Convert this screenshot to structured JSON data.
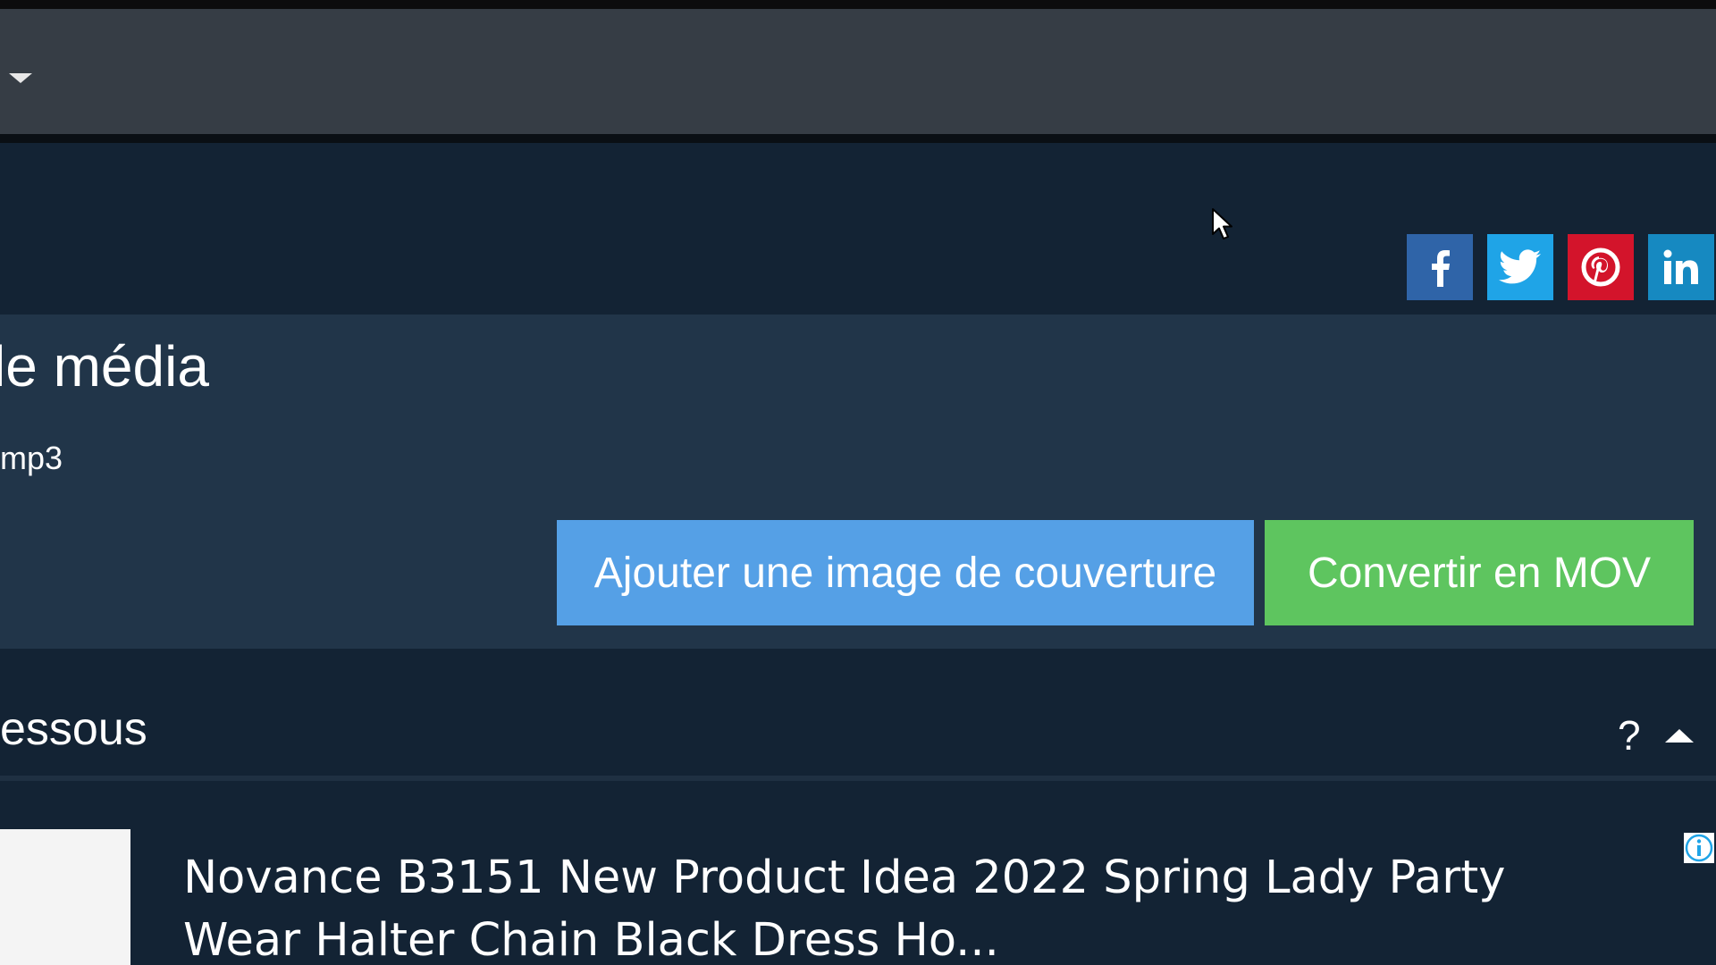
{
  "header": {
    "share_buttons": [
      {
        "name": "Facebook",
        "icon": "facebook-icon",
        "color": "#2f64a8"
      },
      {
        "name": "Twitter",
        "icon": "twitter-icon",
        "color": "#1fa4e7"
      },
      {
        "name": "Pinterest",
        "icon": "pinterest-icon",
        "color": "#d3142b"
      },
      {
        "name": "LinkedIn",
        "icon": "linkedin-icon",
        "color": "#1689c1"
      }
    ]
  },
  "media": {
    "title": "le média",
    "subtitle": "mp3",
    "cover_button_label": "Ajouter une image de couverture",
    "convert_button_label": "Convertir en MOV"
  },
  "section": {
    "title": "essous",
    "help_label": "?"
  },
  "ad": {
    "title": "Novance B3151 New Product Idea 2022 Spring Lady Party\nWear Halter Chain Black Dress Ho..."
  },
  "colors": {
    "navbar": "#363d45",
    "header_bg": "#132334",
    "panel_bg": "#213549",
    "cover_button": "#55a0e6",
    "convert_button": "#5ec55f"
  }
}
